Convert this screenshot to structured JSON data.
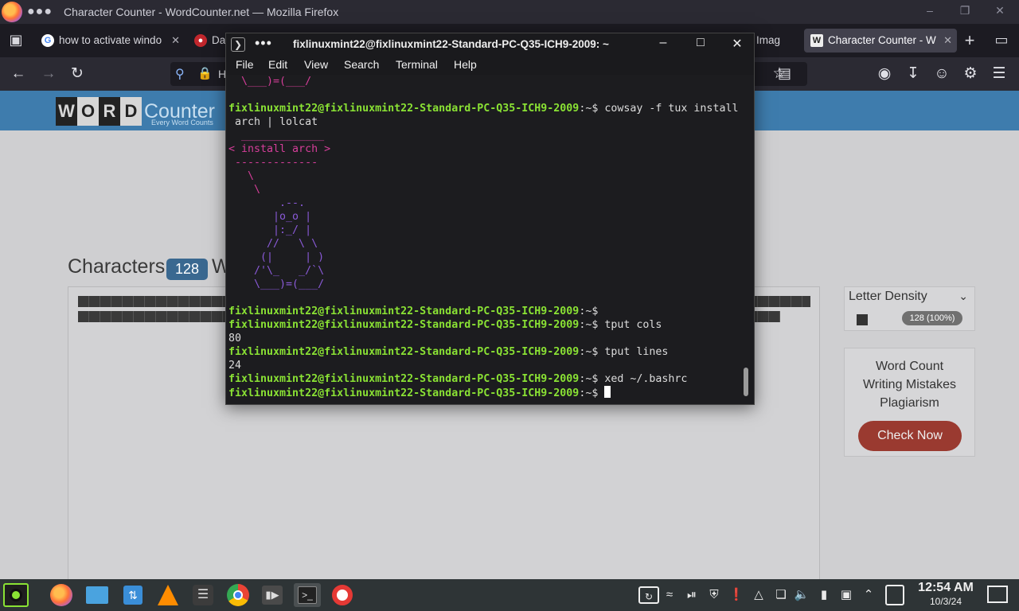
{
  "firefox": {
    "window_title": "Character Counter - WordCounter.net — Mozilla Firefox",
    "title_dots": "●●●",
    "tabs": [
      {
        "label": "how to activate windo"
      },
      {
        "label": "Da"
      },
      {
        "label": "Imag"
      },
      {
        "label": "Character Counter - W"
      }
    ],
    "url_partial": "H"
  },
  "site": {
    "logo_letters": [
      "W",
      "O",
      "R",
      "D"
    ],
    "logo_word": "Counter",
    "logo_tagline": "Every Word Counts",
    "characters_label": "Characters",
    "characters_count": "128",
    "words_label_partial": "W",
    "letter_density": {
      "title": "Letter Density",
      "value": "128 (100%)"
    },
    "ad": {
      "line1": "Word Count",
      "line2": "Writing Mistakes",
      "line3": "Plagiarism",
      "button": "Check Now",
      "button_color": "#9a3a30"
    }
  },
  "terminal": {
    "title": "fixlinuxmint22@fixlinuxmint22-Standard-PC-Q35-ICH9-2009: ~",
    "menu": [
      "File",
      "Edit",
      "View",
      "Search",
      "Terminal",
      "Help"
    ],
    "prompt": "fixlinuxmint22@fixlinuxmint22-Standard-PC-Q35-ICH9-2009",
    "prompt_suffix": ":~$",
    "lines": {
      "l0": "  \\___)=(___/",
      "cmd1": " cowsay -f tux install",
      "cmd1_cont": " arch | lolcat",
      "bubble_top": "  _____________",
      "bubble_text": "< install arch >",
      "bubble_bottom": " -------------",
      "tux1": "   \\",
      "tux2": "    \\",
      "tux3": "        .--.",
      "tux4": "       |o_o |",
      "tux5": "       |:_/ |",
      "tux6": "      //   \\ \\",
      "tux7": "     (|     | )",
      "tux8": "    /'\\_   _/`\\",
      "tux9": "    \\___)=(___/",
      "cmd2": "",
      "cmd3": " tput cols",
      "out3": "80",
      "cmd4": " tput lines",
      "out4": "24",
      "cmd5": " xed ~/.bashrc",
      "cmd6": " "
    },
    "colors": {
      "prompt": "#8ae234",
      "bubble": "#d63e9a",
      "tux": "#8a5ad8"
    }
  },
  "taskbar": {
    "clock_time": "12:54 AM",
    "clock_date": "10/3/24"
  }
}
